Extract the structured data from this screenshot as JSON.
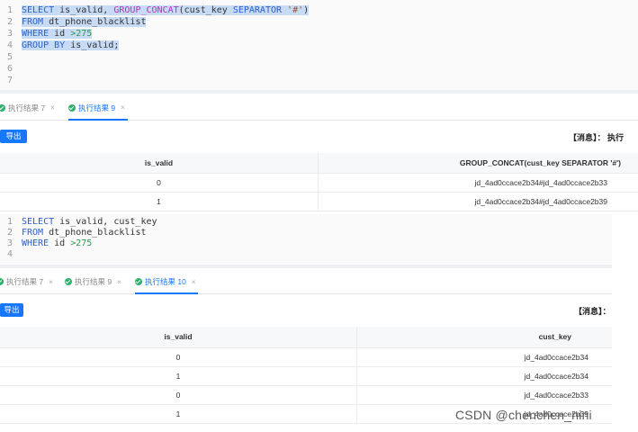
{
  "editor1": {
    "lines": [
      {
        "n": "1",
        "parts": [
          [
            "kw",
            "SELECT"
          ],
          [
            "p",
            " is_valid, "
          ],
          [
            "fn",
            "GROUP_CONCAT"
          ],
          [
            "p",
            "(cust_key "
          ],
          [
            "kw",
            "SEPARATOR"
          ],
          [
            "p",
            " "
          ],
          [
            "str",
            "'#'"
          ],
          [
            "p",
            ")"
          ]
        ]
      },
      {
        "n": "2",
        "parts": [
          [
            "kw",
            "FROM"
          ],
          [
            "p",
            " dt_phone_blacklist"
          ]
        ]
      },
      {
        "n": "3",
        "parts": [
          [
            "kw",
            "WHERE"
          ],
          [
            "p",
            " id "
          ],
          [
            "num",
            ">275"
          ]
        ]
      },
      {
        "n": "4",
        "parts": [
          [
            "kw",
            "GROUP BY"
          ],
          [
            "p",
            " is_valid;"
          ]
        ]
      },
      {
        "n": "5",
        "parts": []
      },
      {
        "n": "6",
        "parts": []
      },
      {
        "n": "7",
        "parts": []
      }
    ]
  },
  "tabs1": [
    {
      "label": "执行结果 7",
      "active": false
    },
    {
      "label": "执行结果 9",
      "active": true
    }
  ],
  "result1": {
    "export_label": "导出",
    "message": "【消息】： 执行",
    "columns": [
      "is_valid",
      "GROUP_CONCAT(cust_key SEPARATOR '#')"
    ],
    "rows": [
      [
        "0",
        "jd_4ad0ccace2b34#jd_4ad0ccace2b33"
      ],
      [
        "1",
        "jd_4ad0ccace2b34#jd_4ad0ccace2b39"
      ]
    ]
  },
  "editor2": {
    "lines": [
      {
        "n": "1",
        "parts": [
          [
            "kw",
            "SELECT"
          ],
          [
            "p",
            " is_valid, cust_key"
          ]
        ]
      },
      {
        "n": "2",
        "parts": [
          [
            "kw",
            "FROM"
          ],
          [
            "p",
            " dt_phone_blacklist"
          ]
        ]
      },
      {
        "n": "3",
        "parts": [
          [
            "kw",
            "WHERE"
          ],
          [
            "p",
            " id "
          ],
          [
            "num",
            ">275"
          ]
        ]
      },
      {
        "n": "4",
        "parts": []
      }
    ]
  },
  "tabs2": [
    {
      "label": "执行结果 7",
      "active": false
    },
    {
      "label": "执行结果 9",
      "active": false
    },
    {
      "label": "执行结果 10",
      "active": true
    }
  ],
  "result2": {
    "export_label": "导出",
    "message": "【消息】：",
    "columns": [
      "is_valid",
      "cust_key"
    ],
    "rows": [
      [
        "0",
        "jd_4ad0ccace2b34"
      ],
      [
        "1",
        "jd_4ad0ccace2b34"
      ],
      [
        "0",
        "jd_4ad0ccace2b33"
      ],
      [
        "1",
        "jd_4ad0ccace2b39"
      ]
    ]
  },
  "watermark": "CSDN @chenchen_nini"
}
